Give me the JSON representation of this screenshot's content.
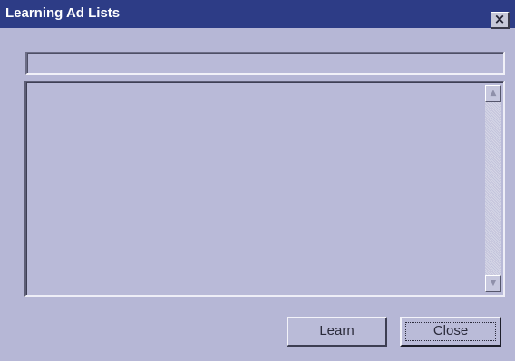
{
  "window": {
    "title": "Learning Ad Lists",
    "close_glyph": "×"
  },
  "status_field": {
    "value": ""
  },
  "list": {
    "items": []
  },
  "scrollbar": {
    "up_glyph": "▲",
    "down_glyph": "▼"
  },
  "buttons": {
    "learn_label": "Learn",
    "close_label": "Close"
  },
  "colors": {
    "title_bar": "#2d3c86",
    "dialog_face": "#b6b7d6"
  },
  "icons": {
    "close": "close-icon",
    "scroll_up": "scroll-up-arrow-icon",
    "scroll_down": "scroll-down-arrow-icon"
  }
}
